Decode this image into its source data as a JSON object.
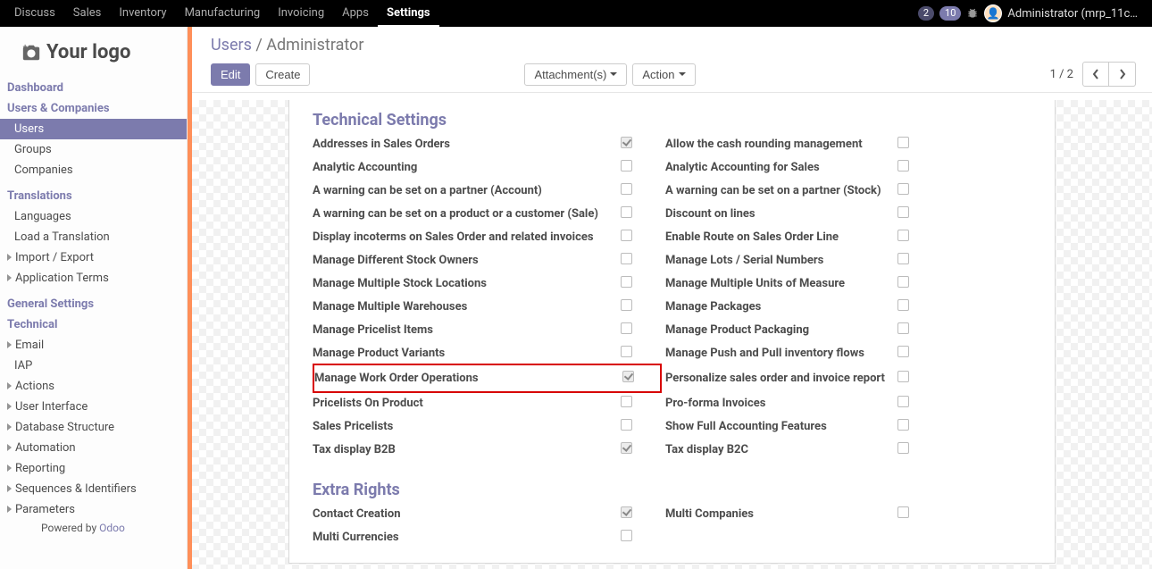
{
  "topmenu": [
    "Discuss",
    "Sales",
    "Inventory",
    "Manufacturing",
    "Invoicing",
    "Apps",
    "Settings"
  ],
  "topmenu_active": 6,
  "badges": {
    "first": "2",
    "second": "10"
  },
  "user": "Administrator (mrp_11c…",
  "logo_text": "Your logo",
  "sidebar": {
    "dashboard": "Dashboard",
    "users_comp": "Users & Companies",
    "users": "Users",
    "groups": "Groups",
    "companies": "Companies",
    "translations": "Translations",
    "languages": "Languages",
    "load_trans": "Load a Translation",
    "imp_exp": "Import / Export",
    "app_terms": "Application Terms",
    "general": "General Settings",
    "technical": "Technical",
    "email": "Email",
    "iap": "IAP",
    "actions": "Actions",
    "ui": "User Interface",
    "db": "Database Structure",
    "automation": "Automation",
    "reporting": "Reporting",
    "seq": "Sequences & Identifiers",
    "params": "Parameters"
  },
  "powered_prefix": "Powered by ",
  "powered_link": "Odoo",
  "breadcrumb": {
    "parent": "Users",
    "sep": " /  ",
    "current": "Administrator"
  },
  "buttons": {
    "edit": "Edit",
    "create": "Create",
    "attachments": "Attachment(s)",
    "action": "Action"
  },
  "pager": "1 / 2",
  "section_technical": "Technical Settings",
  "section_extra": "Extra Rights",
  "tech_rows": [
    {
      "l": "Addresses in Sales Orders",
      "lc": true,
      "r": "Allow the cash rounding management",
      "rc": false
    },
    {
      "l": "Analytic Accounting",
      "lc": false,
      "r": "Analytic Accounting for Sales",
      "rc": false
    },
    {
      "l": "A warning can be set on a partner (Account)",
      "lc": false,
      "r": "A warning can be set on a partner (Stock)",
      "rc": false
    },
    {
      "l": "A warning can be set on a product or a customer (Sale)",
      "lc": false,
      "r": "Discount on lines",
      "rc": false
    },
    {
      "l": "Display incoterms on Sales Order and related invoices",
      "lc": false,
      "r": "Enable Route on Sales Order Line",
      "rc": false
    },
    {
      "l": "Manage Different Stock Owners",
      "lc": false,
      "r": "Manage Lots / Serial Numbers",
      "rc": false
    },
    {
      "l": "Manage Multiple Stock Locations",
      "lc": false,
      "r": "Manage Multiple Units of Measure",
      "rc": false
    },
    {
      "l": "Manage Multiple Warehouses",
      "lc": false,
      "r": "Manage Packages",
      "rc": false
    },
    {
      "l": "Manage Pricelist Items",
      "lc": false,
      "r": "Manage Product Packaging",
      "rc": false
    },
    {
      "l": "Manage Product Variants",
      "lc": false,
      "r": "Manage Push and Pull inventory flows",
      "rc": false
    },
    {
      "l": "Manage Work Order Operations",
      "lc": true,
      "r": "Personalize sales order and invoice report",
      "rc": false,
      "highlight": true
    },
    {
      "l": "Pricelists On Product",
      "lc": false,
      "r": "Pro-forma Invoices",
      "rc": false
    },
    {
      "l": "Sales Pricelists",
      "lc": false,
      "r": "Show Full Accounting Features",
      "rc": false
    },
    {
      "l": "Tax display B2B",
      "lc": true,
      "r": "Tax display B2C",
      "rc": false
    }
  ],
  "extra_rows": [
    {
      "l": "Contact Creation",
      "lc": true,
      "r": "Multi Companies",
      "rc": false
    },
    {
      "l": "Multi Currencies",
      "lc": false,
      "r": "",
      "rc": null
    }
  ]
}
